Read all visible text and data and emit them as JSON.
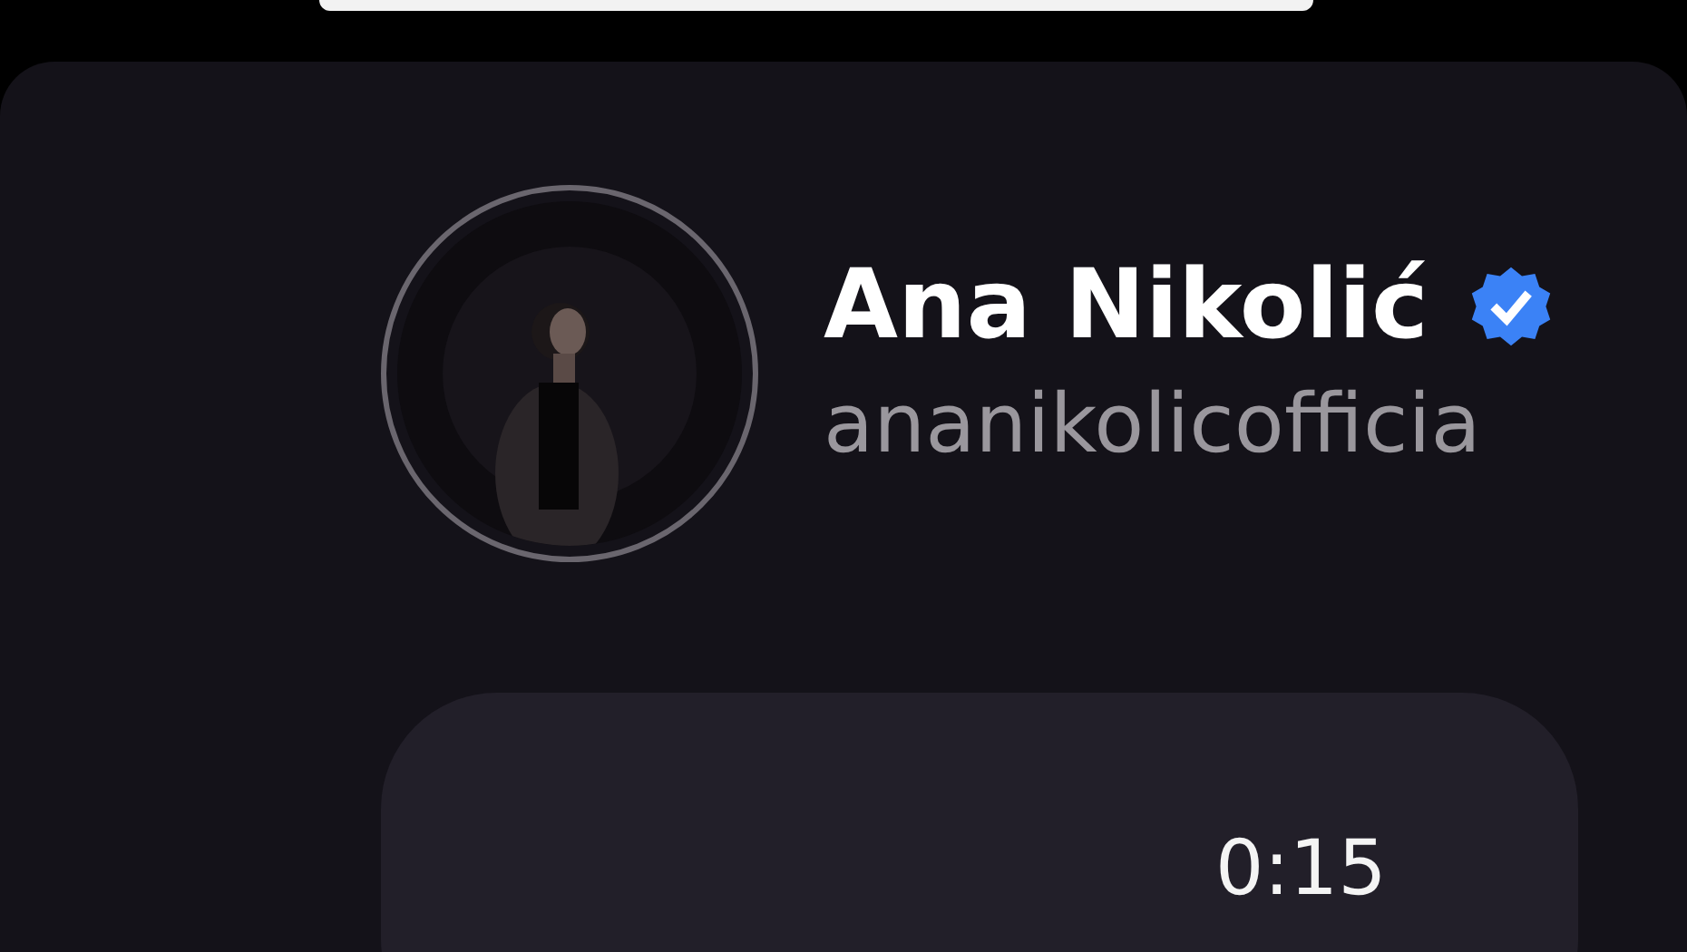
{
  "profile": {
    "name": "Ana Nikolić",
    "verified": true,
    "handle": "ananikolicofficia"
  },
  "voice_message": {
    "duration": "0:15"
  }
}
